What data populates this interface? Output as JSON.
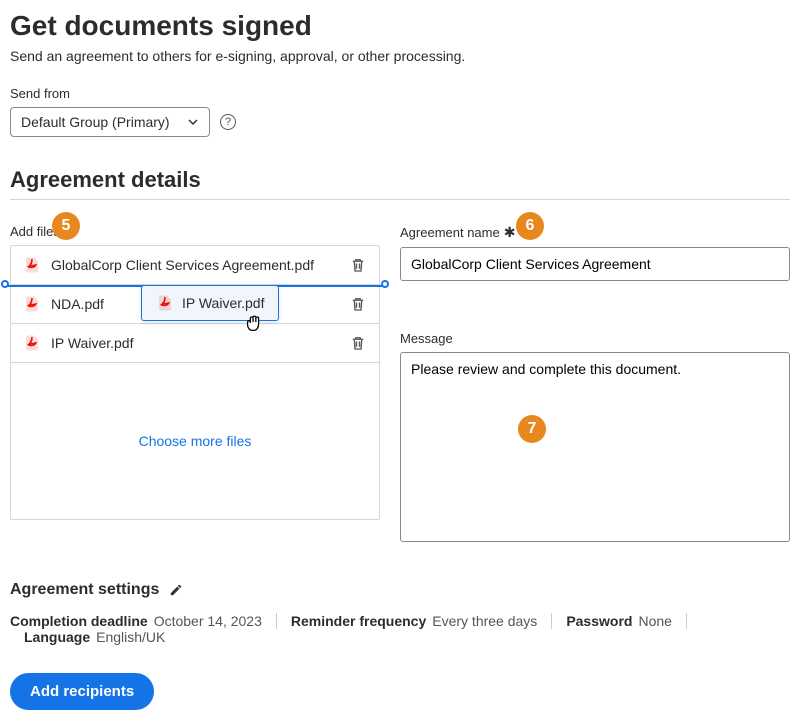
{
  "header": {
    "title": "Get documents signed",
    "subtitle": "Send an agreement to others for e-signing, approval, or other processing."
  },
  "sendFrom": {
    "label": "Send from",
    "selected": "Default Group (Primary)"
  },
  "section": {
    "title": "Agreement details"
  },
  "addFiles": {
    "label": "Add files",
    "items": [
      {
        "name": "GlobalCorp Client Services Agreement.pdf"
      },
      {
        "name": "NDA.pdf"
      },
      {
        "name": "IP Waiver.pdf"
      }
    ],
    "dragItem": "IP Waiver.pdf",
    "chooseMore": "Choose more files"
  },
  "agreementName": {
    "label": "Agreement name",
    "value": "GlobalCorp Client Services Agreement"
  },
  "message": {
    "label": "Message",
    "value": "Please review and complete this document."
  },
  "badges": {
    "b5": "5",
    "b6": "6",
    "b7": "7"
  },
  "settings": {
    "title": "Agreement settings",
    "items": [
      {
        "label": "Completion deadline",
        "value": "October 14, 2023"
      },
      {
        "label": "Reminder frequency",
        "value": "Every three days"
      },
      {
        "label": "Password",
        "value": "None"
      },
      {
        "label": "Language",
        "value": "English/UK"
      }
    ]
  },
  "actions": {
    "addRecipients": "Add recipients"
  }
}
